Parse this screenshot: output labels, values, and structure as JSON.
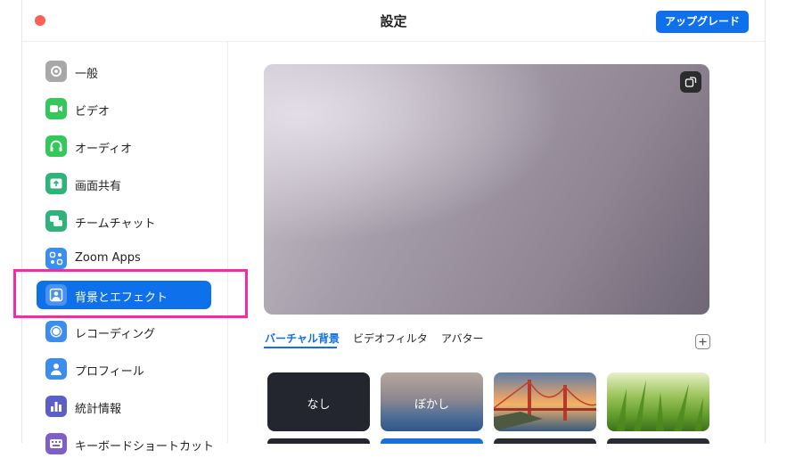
{
  "window": {
    "title": "設定",
    "upgrade_label": "アップグレード"
  },
  "sidebar": {
    "items": [
      {
        "label": "一般",
        "icon": "gear-icon",
        "color": "#9a9a9a"
      },
      {
        "label": "ビデオ",
        "icon": "video-camera-icon",
        "color": "#34c759"
      },
      {
        "label": "オーディオ",
        "icon": "headphones-icon",
        "color": "#34c759"
      },
      {
        "label": "画面共有",
        "icon": "share-screen-icon",
        "color": "#30b37b"
      },
      {
        "label": "チームチャット",
        "icon": "chat-icon",
        "color": "#30b37b"
      },
      {
        "label": "Zoom Apps",
        "icon": "apps-icon",
        "color": "#3b8ef0"
      },
      {
        "label": "背景とエフェクト",
        "icon": "person-background-icon",
        "color": "#0e71eb",
        "active": true
      },
      {
        "label": "レコーディング",
        "icon": "record-icon",
        "color": "#3b8ef0"
      },
      {
        "label": "プロフィール",
        "icon": "profile-icon",
        "color": "#3b8ef0"
      },
      {
        "label": "統計情報",
        "icon": "stats-icon",
        "color": "#5b5fc7"
      },
      {
        "label": "キーボードショートカット",
        "icon": "keyboard-icon",
        "color": "#7d5fc7"
      }
    ]
  },
  "main": {
    "tabs": [
      {
        "label": "バーチャル背景",
        "active": true
      },
      {
        "label": "ビデオフィルタ"
      },
      {
        "label": "アバター"
      }
    ],
    "thumbnails": [
      {
        "label": "なし"
      },
      {
        "label": "ぼかし"
      },
      {
        "label": ""
      },
      {
        "label": ""
      }
    ]
  },
  "colors": {
    "accent": "#0e71eb",
    "highlight": "#f52ba5",
    "close": "#fe5f57"
  }
}
